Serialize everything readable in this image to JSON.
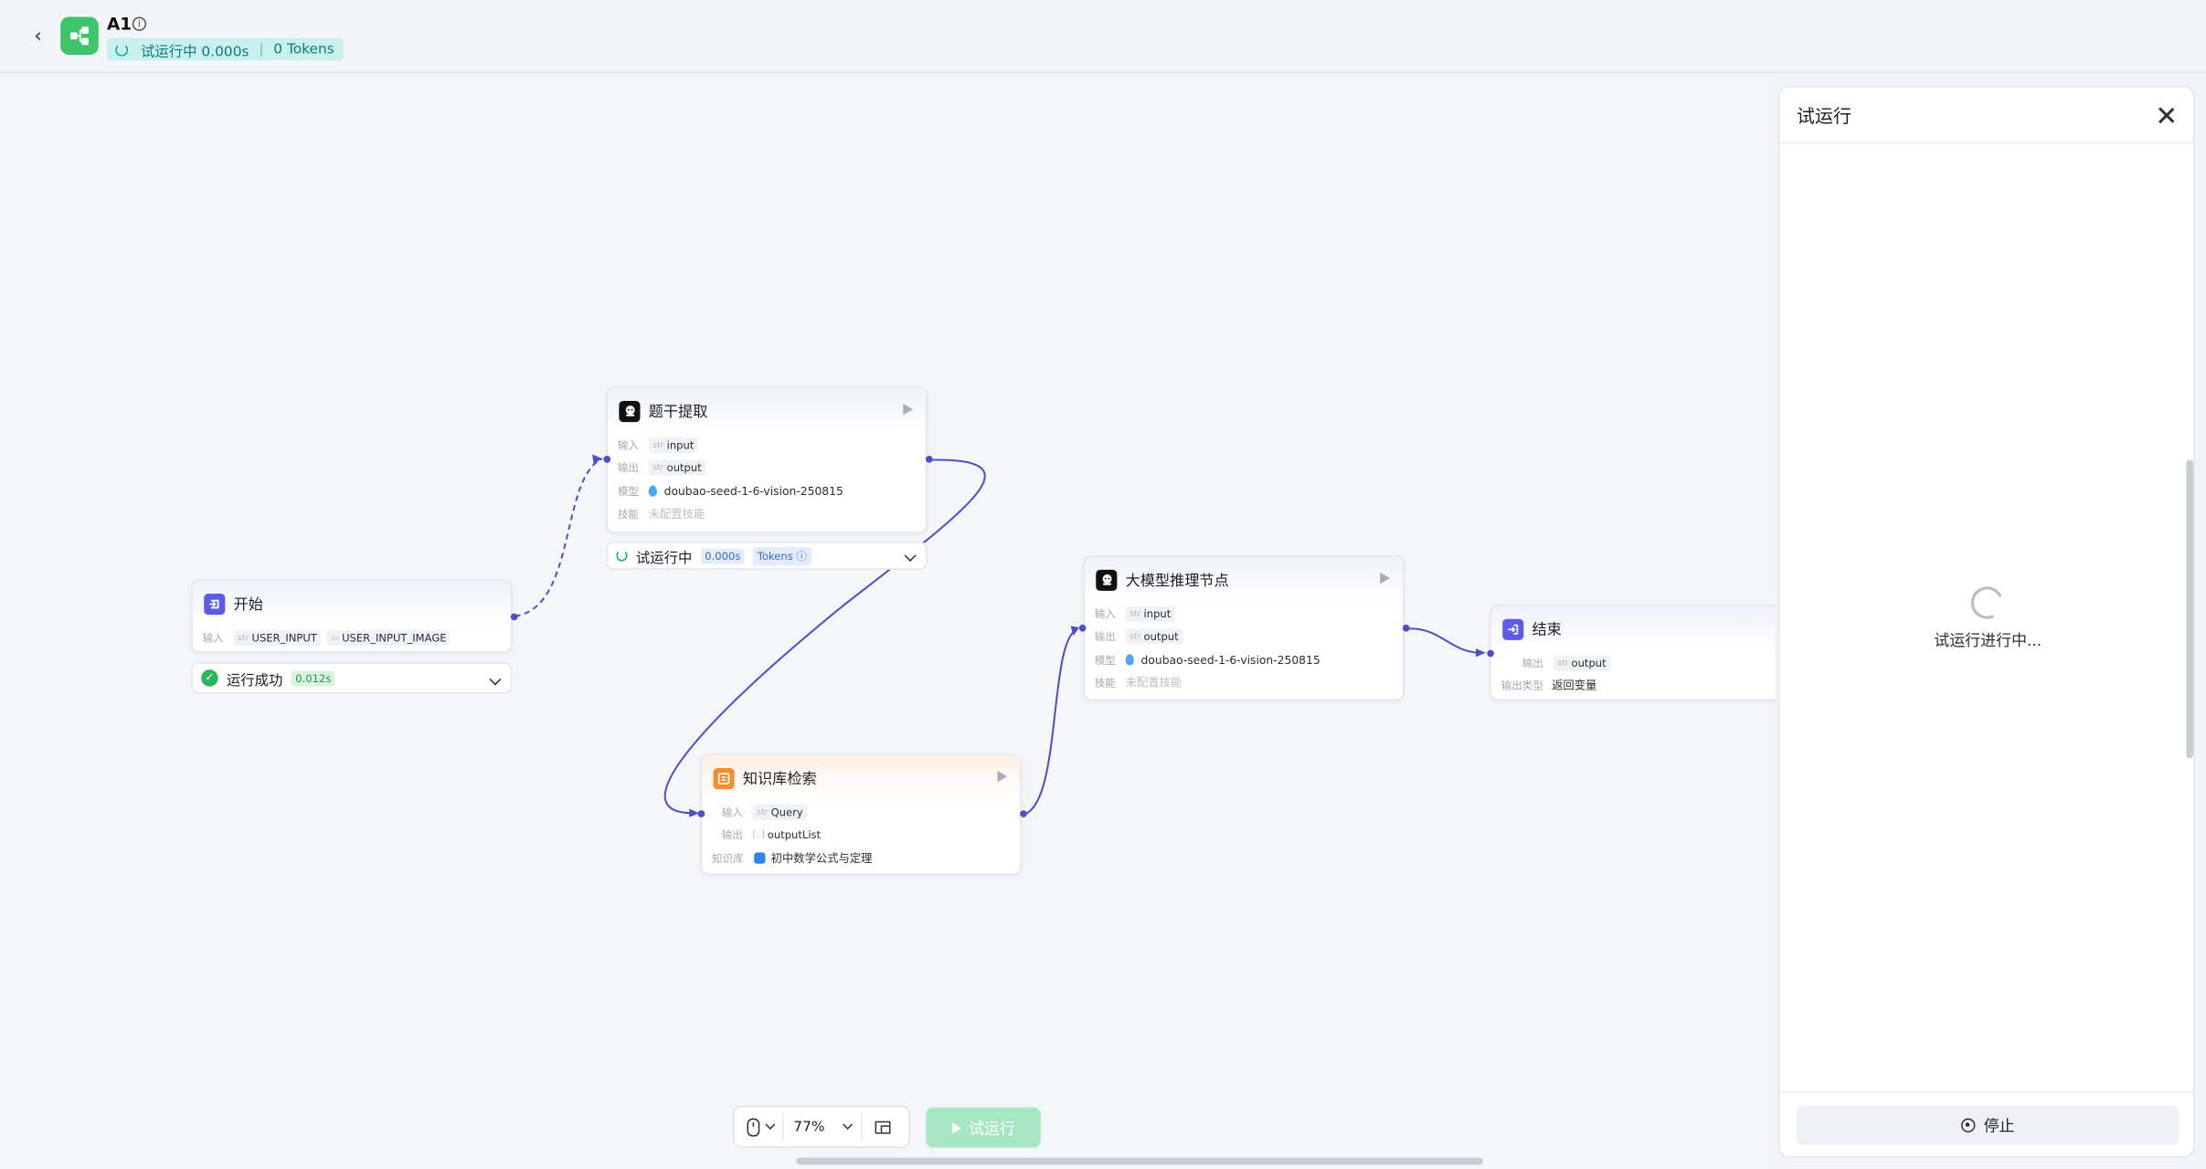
{
  "header": {
    "app_name": "A1",
    "status_running": "试运行中 0.000s",
    "status_tokens": "0 Tokens"
  },
  "nodes": {
    "start": {
      "title": "开始",
      "input_label": "输入",
      "inputs": [
        "USER_INPUT",
        "USER_INPUT_IMAGE"
      ],
      "status": "运行成功",
      "time": "0.012s"
    },
    "extract": {
      "title": "题干提取",
      "input_label": "输入",
      "input": "input",
      "output_label": "输出",
      "output": "output",
      "model_label": "模型",
      "model": "doubao-seed-1-6-vision-250815",
      "skill_label": "技能",
      "skill": "未配置技能",
      "status": "试运行中",
      "time": "0.000s",
      "tokens": "Tokens"
    },
    "kb": {
      "title": "知识库检索",
      "input_label": "输入",
      "input": "Query",
      "output_label": "输出",
      "output": "outputList",
      "kb_label": "知识库",
      "kb": "初中数学公式与定理"
    },
    "llm": {
      "title": "大模型推理节点",
      "input_label": "输入",
      "input": "input",
      "output_label": "输出",
      "output": "output",
      "model_label": "模型",
      "model": "doubao-seed-1-6-vision-250815",
      "skill_label": "技能",
      "skill": "未配置技能"
    },
    "end": {
      "title": "结束",
      "output_label": "输出",
      "output": "output",
      "output_type_label": "输出类型",
      "output_type": "返回变量"
    }
  },
  "toolbar": {
    "zoom": "77%",
    "run_label": "试运行"
  },
  "panel": {
    "title": "试运行",
    "loading_text": "试运行进行中...",
    "stop_label": "停止"
  },
  "colors": {
    "accent": "#4d4fc4",
    "success": "#2bb65a",
    "run_button": "#a7e6c3",
    "status_pill": "#c9f0ec"
  }
}
